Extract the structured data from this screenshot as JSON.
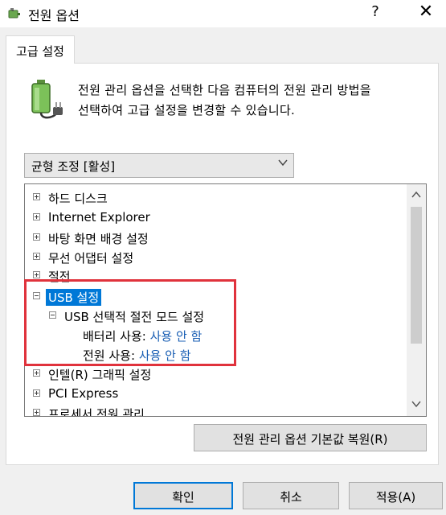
{
  "window": {
    "title": "전원 옵션",
    "help_label": "?",
    "close_label": "✕"
  },
  "tab": {
    "label": "고급 설정"
  },
  "description": {
    "line1": "전원 관리 옵션을 선택한 다음 컴퓨터의 전원 관리 방법을",
    "line2": "선택하여 고급 설정을 변경할 수 있습니다."
  },
  "plan": {
    "selected": "균형 조정 [활성]"
  },
  "tree": {
    "hard_disk": "하드 디스크",
    "ie": "Internet Explorer",
    "desktop_bg": "바탕 화면 배경 설정",
    "wireless": "무선 어댑터 설정",
    "sleep": "절전",
    "usb": "USB 설정",
    "usb_selective": "USB 선택적 절전 모드 설정",
    "battery_label": "배터리 사용:",
    "battery_value": "사용 안 함",
    "plugged_label": "전원 사용:",
    "plugged_value": "사용 안 함",
    "intel_graphics": "인텔(R) 그래픽 설정",
    "pci_express": "PCI Express",
    "processor": "프로세서 전원 관리"
  },
  "buttons": {
    "restore": "전원 관리 옵션 기본값 복원(R)",
    "ok": "확인",
    "cancel": "취소",
    "apply": "적용(A)"
  },
  "colors": {
    "selection": "#0078d7",
    "highlight_box": "#e0323c",
    "value_link": "#1a5fb4"
  }
}
